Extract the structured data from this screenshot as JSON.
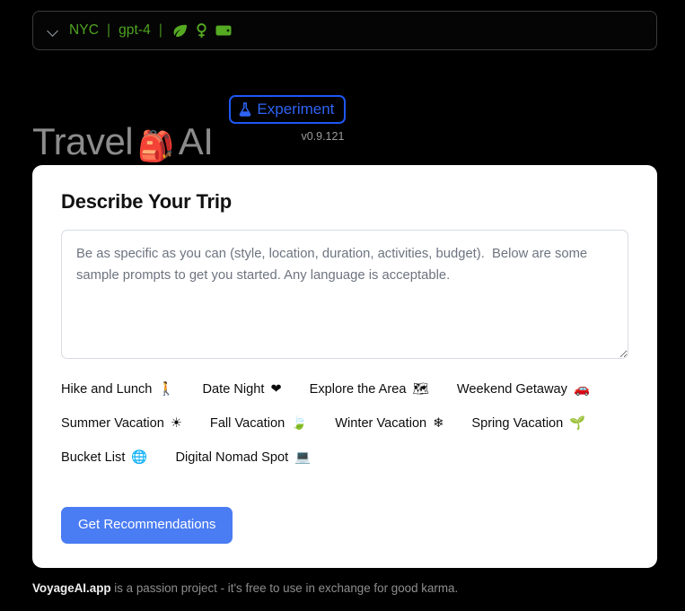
{
  "topbar": {
    "chevron_icon": "chevron-down-icon",
    "location": "NYC",
    "separator": "|",
    "model": "gpt-4",
    "icons": [
      {
        "name": "leaf-icon",
        "color": "#55aa22"
      },
      {
        "name": "venus-icon",
        "color": "#55aa22"
      },
      {
        "name": "wallet-icon",
        "color": "#55aa22"
      }
    ]
  },
  "header": {
    "title_part1": "Travel",
    "title_emoji": "🎒",
    "title_part2": "AI",
    "badge_label": "Experiment",
    "badge_icon": "flask-icon",
    "version": "v0.9.121"
  },
  "card": {
    "heading": "Describe Your Trip",
    "textarea": {
      "value": "",
      "placeholder": "Be as specific as you can (style, location, duration, activities, budget).  Below are some sample prompts to get you started. Any language is acceptable."
    },
    "prompt_rows": [
      [
        {
          "label": "Hike and Lunch",
          "emoji": "🚶",
          "icon": "hiker-icon"
        },
        {
          "label": "Date Night",
          "emoji": "❤",
          "icon": "heart-icon"
        },
        {
          "label": "Explore the Area",
          "emoji": "🗺",
          "icon": "map-icon"
        },
        {
          "label": "Weekend Getaway",
          "emoji": "🚗",
          "icon": "car-icon"
        }
      ],
      [
        {
          "label": "Summer Vacation",
          "emoji": "☀",
          "icon": "sun-icon"
        },
        {
          "label": "Fall Vacation",
          "emoji": "🍃",
          "icon": "leaf-icon"
        },
        {
          "label": "Winter Vacation",
          "emoji": "❄",
          "icon": "snowflake-icon"
        },
        {
          "label": "Spring Vacation",
          "emoji": "🌱",
          "icon": "seedling-icon"
        }
      ],
      [
        {
          "label": "Bucket List",
          "emoji": "🌐",
          "icon": "globe-icon"
        },
        {
          "label": "Digital Nomad Spot",
          "emoji": "💻",
          "icon": "laptop-icon"
        }
      ]
    ],
    "cta_label": "Get Recommendations"
  },
  "footer": {
    "brand": "VoyageAI.app",
    "text": " is a passion project - it's free to use in exchange for good karma."
  },
  "colors": {
    "background": "#000000",
    "accent_green": "#4fa521",
    "accent_blue": "#4a7cf3",
    "badge_blue": "#2f63f5",
    "card_background": "#ffffff"
  }
}
